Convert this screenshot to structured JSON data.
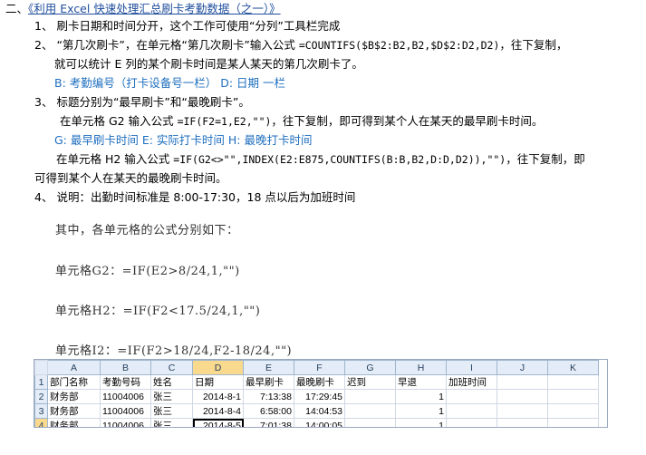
{
  "heading": {
    "prefix": "二、",
    "link": "《利用 Excel 快速处理汇总刷卡考勤数据（之一）》"
  },
  "steps": [
    {
      "num": "1、",
      "text": "刷卡日期和时间分开，这个工作可使用“分列”工具栏完成"
    },
    {
      "num": "2、",
      "text_a": "“第几次刷卡”，在单元格“第几次刷卡”输入公式 ",
      "formula": "=COUNTIFS($B$2:B2,B2,$D$2:D2,D2)",
      "text_b": "，往下复制，",
      "text_c": "就可以统计 E 列的某个刷卡时间是某人某天的第几次刷卡了。",
      "note": "B: 考勤编号（打卡设备号一栏）  D: 日期 一栏"
    },
    {
      "num": "3、",
      "text": "标题分别为“最早刷卡”和“最晚刷卡”。",
      "g2_a": "在单元格 G2 输入公式 ",
      "g2_formula": "=IF(F2=1,E2,\"\")",
      "g2_b": "，往下复制，即可得到某个人在某天的最早刷卡时间。",
      "note": "G: 最早刷卡时间 E: 实际打卡时间 H: 最晚打卡时间",
      "h2_a": "在单元格 H2 输入公式 ",
      "h2_formula": "=IF(G2<>\"\",INDEX(E2:E875,COUNTIFS(B:B,B2,D:D,D2)),\"\")",
      "h2_b": "，往下复制，即",
      "h2_c": "可得到某个人在某天的最晚刷卡时间。"
    },
    {
      "num": "4、",
      "text": "说明：出勤时间标准是 8:00-17:30，18 点以后为加班时间"
    }
  ],
  "image_text": {
    "intro": "其中，各单元格的公式分别如下：",
    "g2": "单元格G2：=IF(E2>8/24,1,\"\")",
    "h2": "单元格H2：=IF(F2<17.5/24,1,\"\")",
    "i2": "单元格I2：=IF(F2>18/24,F2-18/24,\"\")"
  },
  "sheet": {
    "columns": [
      "A",
      "B",
      "C",
      "D",
      "E",
      "F",
      "G",
      "H",
      "I",
      "J",
      "K"
    ],
    "rows": [
      {
        "n": "1",
        "cells": [
          "部门名称",
          "考勤号码",
          "姓名",
          "日期",
          "最早刷卡",
          "最晚刷卡",
          "迟到",
          "早退",
          "加班时间",
          "",
          ""
        ]
      },
      {
        "n": "2",
        "cells": [
          "财务部",
          "11004006",
          "张三",
          "2014-8-1",
          "7:13:38",
          "17:29:45",
          "",
          "1",
          "",
          "",
          ""
        ]
      },
      {
        "n": "3",
        "cells": [
          "财务部",
          "11004006",
          "张三",
          "2014-8-4",
          "6:58:00",
          "14:04:53",
          "",
          "1",
          "",
          "",
          ""
        ]
      },
      {
        "n": "4",
        "cells": [
          "财务部",
          "11004006",
          "张三",
          "2014-8-5",
          "7:01:38",
          "14:00:05",
          "",
          "1",
          "",
          "",
          ""
        ]
      }
    ]
  }
}
